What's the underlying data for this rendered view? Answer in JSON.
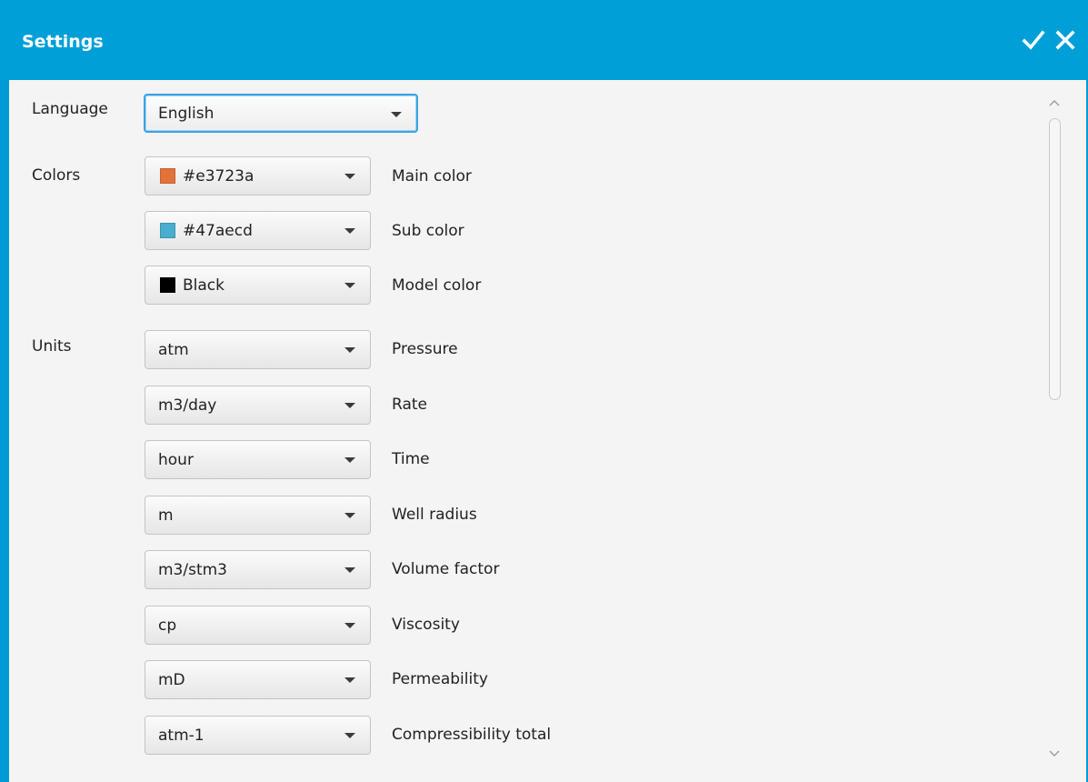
{
  "window": {
    "title": "Settings",
    "title_bar_color": "#009fd8"
  },
  "titlebar_buttons": {
    "confirm_icon": "check-icon",
    "close_icon": "close-icon"
  },
  "language": {
    "label": "Language",
    "value": "English"
  },
  "colors": {
    "label": "Colors",
    "items": [
      {
        "value": "#e3723a",
        "swatch": "#e3723a",
        "field": "Main color"
      },
      {
        "value": "#47aecd",
        "swatch": "#47aecd",
        "field": "Sub color"
      },
      {
        "value": "Black",
        "swatch": "#000000",
        "field": "Model color"
      }
    ]
  },
  "units": {
    "label": "Units",
    "items": [
      {
        "value": "atm",
        "field": "Pressure"
      },
      {
        "value": "m3/day",
        "field": "Rate"
      },
      {
        "value": "hour",
        "field": "Time"
      },
      {
        "value": "m",
        "field": "Well radius"
      },
      {
        "value": "m3/stm3",
        "field": "Volume factor"
      },
      {
        "value": "cp",
        "field": "Viscosity"
      },
      {
        "value": "mD",
        "field": "Permeability"
      },
      {
        "value": "atm-1",
        "field": "Compressibility total"
      }
    ]
  }
}
